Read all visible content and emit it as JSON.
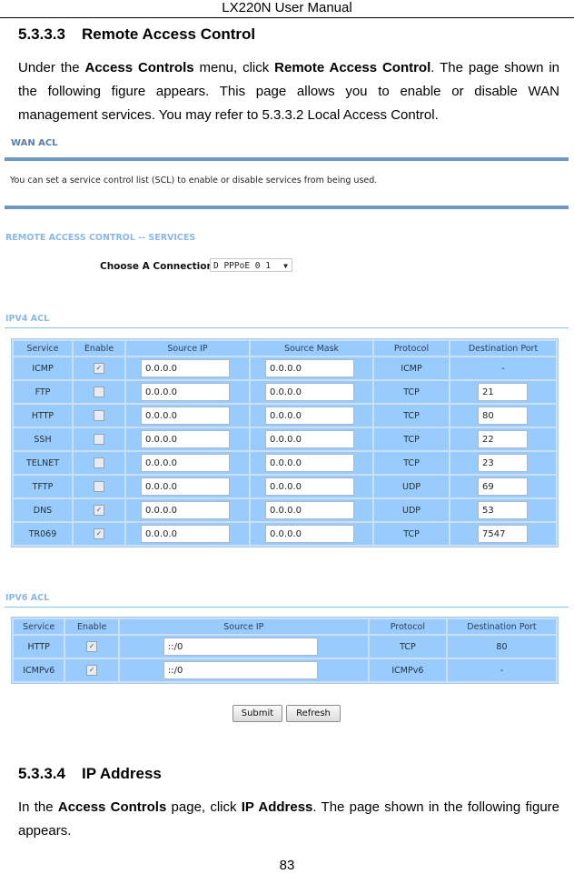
{
  "header": {
    "title": "LX220N User Manual"
  },
  "section1": {
    "number": "5.3.3.3",
    "title": "Remote Access Control",
    "paragraph": {
      "p1": "Under the ",
      "b1": "Access Controls",
      "p2": " menu, click ",
      "b2": "Remote Access Control",
      "p3": ". The page shown in the following figure appears. This page allows you to enable or disable WAN management services. You may refer to 5.3.3.2 Local Access Control."
    }
  },
  "screenshot": {
    "title": "WAN ACL",
    "description": "You can set a service control list (SCL) to enable or disable services from being used.",
    "services_title": "REMOTE ACCESS CONTROL -- SERVICES",
    "connection_label": "Choose A Connection",
    "connection_value": "D PPPoE 0 1",
    "ipv4": {
      "title": "IPV4 ACL",
      "headers": [
        "Service",
        "Enable",
        "Source IP",
        "Source Mask",
        "Protocol",
        "Destination Port"
      ],
      "rows": [
        {
          "service": "ICMP",
          "enabled": true,
          "source_ip": "0.0.0.0",
          "source_mask": "0.0.0.0",
          "protocol": "ICMP",
          "port": "-",
          "port_editable": false
        },
        {
          "service": "FTP",
          "enabled": false,
          "source_ip": "0.0.0.0",
          "source_mask": "0.0.0.0",
          "protocol": "TCP",
          "port": "21",
          "port_editable": true
        },
        {
          "service": "HTTP",
          "enabled": false,
          "source_ip": "0.0.0.0",
          "source_mask": "0.0.0.0",
          "protocol": "TCP",
          "port": "80",
          "port_editable": true
        },
        {
          "service": "SSH",
          "enabled": false,
          "source_ip": "0.0.0.0",
          "source_mask": "0.0.0.0",
          "protocol": "TCP",
          "port": "22",
          "port_editable": true
        },
        {
          "service": "TELNET",
          "enabled": false,
          "source_ip": "0.0.0.0",
          "source_mask": "0.0.0.0",
          "protocol": "TCP",
          "port": "23",
          "port_editable": true
        },
        {
          "service": "TFTP",
          "enabled": false,
          "source_ip": "0.0.0.0",
          "source_mask": "0.0.0.0",
          "protocol": "UDP",
          "port": "69",
          "port_editable": true
        },
        {
          "service": "DNS",
          "enabled": true,
          "source_ip": "0.0.0.0",
          "source_mask": "0.0.0.0",
          "protocol": "UDP",
          "port": "53",
          "port_editable": true
        },
        {
          "service": "TR069",
          "enabled": true,
          "source_ip": "0.0.0.0",
          "source_mask": "0.0.0.0",
          "protocol": "TCP",
          "port": "7547",
          "port_editable": true
        }
      ]
    },
    "ipv6": {
      "title": "IPV6 ACL",
      "headers": [
        "Service",
        "Enable",
        "Source IP",
        "Protocol",
        "Destination Port"
      ],
      "rows": [
        {
          "service": "HTTP",
          "enabled": true,
          "source_ip": "::/0",
          "protocol": "TCP",
          "port": "80"
        },
        {
          "service": "ICMPv6",
          "enabled": true,
          "source_ip": "::/0",
          "protocol": "ICMPv6",
          "port": "-"
        }
      ]
    },
    "buttons": {
      "submit": "Submit",
      "refresh": "Refresh"
    },
    "colors": {
      "bar": "#6f97c1",
      "cell": "#99cbff",
      "section_title": "#8ab8e6"
    }
  },
  "section2": {
    "number": "5.3.3.4",
    "title": "IP Address",
    "paragraph": {
      "p1": "In the ",
      "b1": "Access Controls",
      "p2": " page, click ",
      "b2": "IP Address",
      "p3": ". The page shown in the following figure appears."
    }
  },
  "footer": {
    "page_number": "83"
  }
}
